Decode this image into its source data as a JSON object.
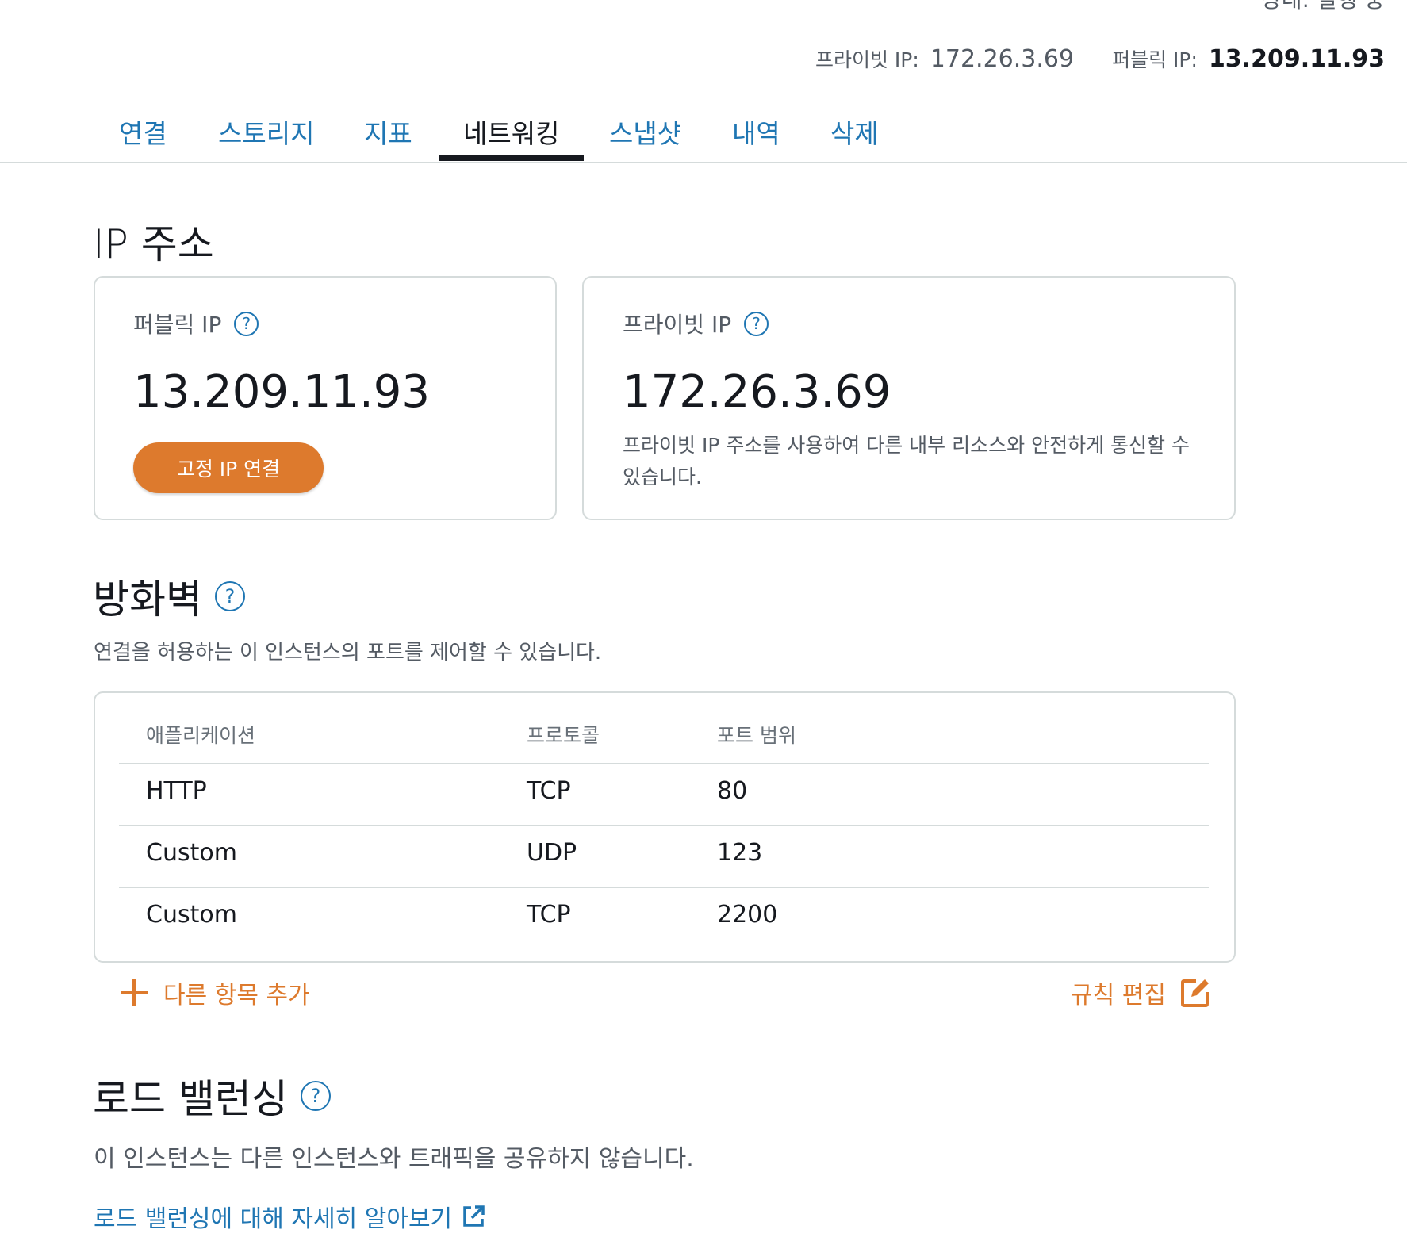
{
  "header": {
    "status_text": "상태: 실행 중",
    "private_ip_label": "프라이빗 IP:",
    "private_ip_value": "172.26.3.69",
    "public_ip_label": "퍼블릭 IP:",
    "public_ip_value": "13.209.11.93"
  },
  "tabs": [
    {
      "label": "연결"
    },
    {
      "label": "스토리지"
    },
    {
      "label": "지표"
    },
    {
      "label": "네트워킹"
    },
    {
      "label": "스냅샷"
    },
    {
      "label": "내역"
    },
    {
      "label": "삭제"
    }
  ],
  "active_tab": "네트워킹",
  "ip_section": {
    "title": "IP 주소",
    "public_card": {
      "label": "퍼블릭 IP",
      "help": "?",
      "value": "13.209.11.93",
      "button": "고정 IP 연결"
    },
    "private_card": {
      "label": "프라이빗 IP",
      "help": "?",
      "value": "172.26.3.69",
      "description": "프라이빗 IP 주소를 사용하여 다른 내부 리소스와 안전하게 통신할 수 있습니다."
    }
  },
  "firewall": {
    "title": "방화벽",
    "help": "?",
    "description": "연결을 허용하는 이 인스턴스의 포트를 제어할 수 있습니다.",
    "columns": [
      "애플리케이션",
      "프로토콜",
      "포트 범위"
    ],
    "rows": [
      {
        "app": "HTTP",
        "protocol": "TCP",
        "port": "80"
      },
      {
        "app": "Custom",
        "protocol": "UDP",
        "port": "123"
      },
      {
        "app": "Custom",
        "protocol": "TCP",
        "port": "2200"
      }
    ],
    "add_label": "다른 항목 추가",
    "edit_label": "규칙 편집"
  },
  "load_balancing": {
    "title": "로드 밸런싱",
    "help": "?",
    "description": "이 인스턴스는 다른 인스턴스와 트래픽을 공유하지 않습니다.",
    "link": "로드 밸런싱에 대해 자세히 알아보기"
  },
  "colors": {
    "accent_orange": "#dd7a2d",
    "link_blue": "#1f76b3",
    "text_dark": "#16191f",
    "text_muted": "#545b64",
    "border": "#d5dbdb"
  }
}
